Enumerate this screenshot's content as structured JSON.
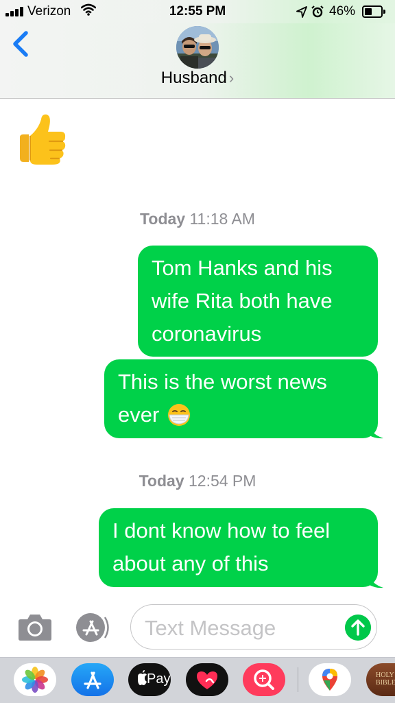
{
  "status_bar": {
    "carrier": "Verizon",
    "time": "12:55 PM",
    "battery_percent": "46%",
    "battery_level": 0.46,
    "icons": [
      "signal-icon",
      "wifi-icon",
      "location-icon",
      "alarm-icon",
      "battery-icon"
    ]
  },
  "header": {
    "contact_name": "Husband",
    "chevron": "›",
    "back_icon": "chevron-left-icon",
    "accent_color": "#1a7cf5"
  },
  "messages": [
    {
      "type": "received",
      "content": "👍",
      "icon": "thumbs-up-emoji"
    },
    {
      "type": "timestamp",
      "day": "Today",
      "time": "11:18 AM"
    },
    {
      "type": "sent",
      "lines": [
        "Tom Hanks and his",
        "wife Rita both have",
        "coronavirus"
      ]
    },
    {
      "type": "sent",
      "lines": [
        "This is the worst news",
        "ever"
      ],
      "emoji": "face-with-medical-mask"
    },
    {
      "type": "timestamp",
      "day": "Today",
      "time": "12:54 PM"
    },
    {
      "type": "sent",
      "lines": [
        "I dont know how to feel",
        "about any of this"
      ]
    }
  ],
  "compose": {
    "placeholder": "Text Message",
    "camera_icon": "camera-icon",
    "apps_icon": "app-store-icon",
    "send_icon": "send-arrow-icon"
  },
  "dock": {
    "apps": [
      {
        "name": "Photos",
        "icon": "photos-icon"
      },
      {
        "name": "App Store",
        "icon": "app-store-icon"
      },
      {
        "name": "Apple Pay",
        "label": "Pay",
        "icon": "apple-pay-icon"
      },
      {
        "name": "Digital Touch",
        "icon": "heart-touch-icon"
      },
      {
        "name": "Images",
        "icon": "image-search-icon"
      },
      {
        "name": "Google Maps",
        "icon": "maps-pin-icon"
      },
      {
        "name": "Holy Bible",
        "label": "HOLY BIBLE",
        "icon": "bible-icon"
      }
    ]
  },
  "colors": {
    "sent_bubble": "#00d149",
    "timestamp": "#8e8e93",
    "send_button": "#00c84a"
  }
}
